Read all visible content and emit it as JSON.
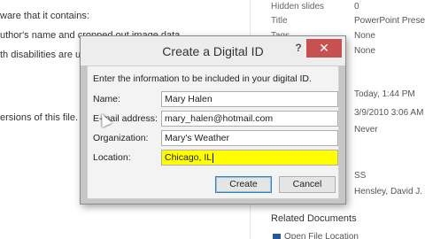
{
  "background_doc": {
    "lines": [
      "ware that it contains:",
      "uthor's name and cropped out image data",
      "th disabilities are u",
      "ersions of this file."
    ]
  },
  "properties": {
    "rows": [
      {
        "label": "Hidden slides",
        "value": "0"
      },
      {
        "label": "Title",
        "value": "PowerPoint Prese"
      },
      {
        "label": "Tags",
        "value": "None"
      },
      {
        "label": "",
        "value": "None"
      },
      {
        "label": "",
        "value": "Today, 1:44 PM"
      },
      {
        "label": "",
        "value": "3/9/2010 3:06 AM"
      },
      {
        "label": "",
        "value": "Never"
      },
      {
        "label": "",
        "value": "SS"
      },
      {
        "label": "",
        "value": "Hensley, David J."
      }
    ],
    "related_title": "Related Documents",
    "related_item": "Open File Location"
  },
  "dialog": {
    "title": "Create a Digital ID",
    "help_label": "?",
    "close_label": "✕",
    "intro": "Enter the information to be included in your digital ID.",
    "fields": {
      "name": {
        "label": "Name:",
        "value": "Mary Halen"
      },
      "email": {
        "label": "E-mail address:",
        "value": "mary_halen@hotmail.com"
      },
      "organization": {
        "label": "Organization:",
        "value": "Mary's Weather"
      },
      "location": {
        "label": "Location:",
        "value": "Chicago, IL"
      }
    },
    "create_label": "Create",
    "cancel_label": "Cancel"
  },
  "colors": {
    "close_button": "#c75050",
    "highlight": "#ffff00",
    "default_button_border": "#3c7fb1"
  }
}
